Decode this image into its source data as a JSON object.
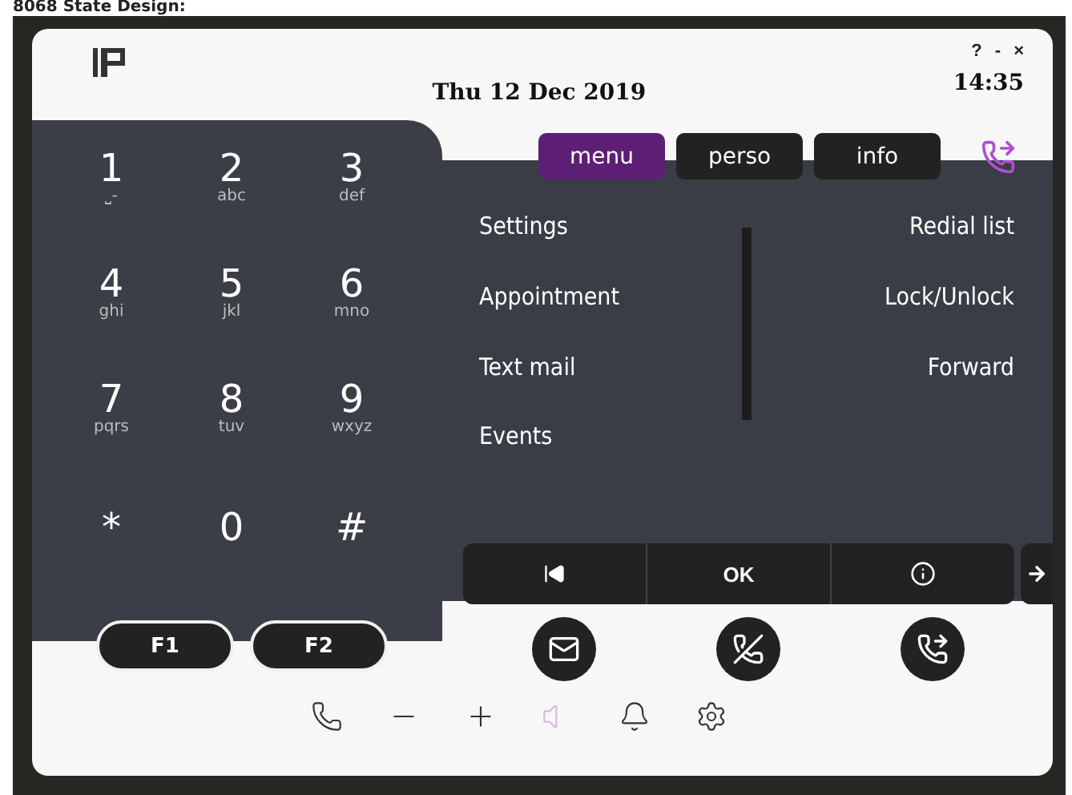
{
  "caption": "8068 State Design:",
  "header": {
    "date": "Thu 12 Dec 2019",
    "time": "14:35",
    "window_controls": [
      "?",
      "-",
      "×"
    ]
  },
  "tabs": [
    {
      "label": "menu",
      "selected": true
    },
    {
      "label": "perso",
      "selected": false
    },
    {
      "label": "info",
      "selected": false
    }
  ],
  "keypad": [
    {
      "digit": "1",
      "letters": "⎵-"
    },
    {
      "digit": "2",
      "letters": "abc"
    },
    {
      "digit": "3",
      "letters": "def"
    },
    {
      "digit": "4",
      "letters": "ghi"
    },
    {
      "digit": "5",
      "letters": "jkl"
    },
    {
      "digit": "6",
      "letters": "mno"
    },
    {
      "digit": "7",
      "letters": "pqrs"
    },
    {
      "digit": "8",
      "letters": "tuv"
    },
    {
      "digit": "9",
      "letters": "wxyz"
    },
    {
      "digit": "*"
    },
    {
      "digit": "0"
    },
    {
      "digit": "#"
    }
  ],
  "menu_left": [
    "Settings",
    "Appointment",
    "Text mail",
    "Events"
  ],
  "menu_right": [
    "Redial list",
    "Lock/Unlock",
    "Forward"
  ],
  "nav_bar": [
    {
      "kind": "first"
    },
    {
      "kind": "text",
      "label": "OK"
    },
    {
      "kind": "info"
    }
  ],
  "function_keys": [
    "F1",
    "F2"
  ],
  "call_buttons": [
    {
      "kind": "mail"
    },
    {
      "kind": "hangup"
    },
    {
      "kind": "transfer"
    }
  ],
  "toolbar": [
    {
      "kind": "handset",
      "disabled": false
    },
    {
      "kind": "minus",
      "disabled": false
    },
    {
      "kind": "plus",
      "disabled": false
    },
    {
      "kind": "speaker",
      "disabled": true
    },
    {
      "kind": "bell",
      "disabled": false
    },
    {
      "kind": "settings",
      "disabled": false
    }
  ]
}
